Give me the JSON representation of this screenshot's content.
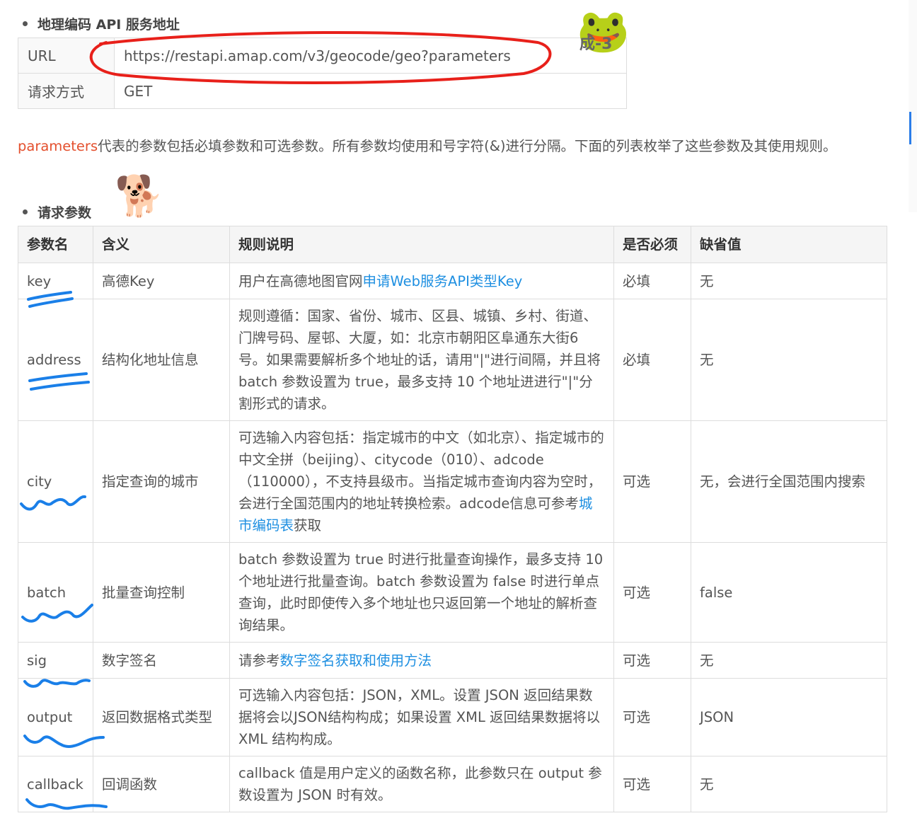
{
  "section1": {
    "title": "地理编码 API 服务地址"
  },
  "url_table": [
    {
      "key": "URL",
      "value": "https://restapi.amap.com/v3/geocode/geo?parameters"
    },
    {
      "key": "请求方式",
      "value": "GET"
    }
  ],
  "description": {
    "highlight": "parameters",
    "text": "代表的参数包括必填参数和可选参数。所有参数均使用和号字符(&)进行分隔。下面的列表枚举了这些参数及其使用规则。"
  },
  "section2": {
    "title": "请求参数"
  },
  "param_table": {
    "headers": [
      "参数名",
      "含义",
      "规则说明",
      "是否必须",
      "缺省值"
    ],
    "rows": [
      {
        "name": "key",
        "meaning": "高德Key",
        "rule_pre": "用户在高德地图官网",
        "rule_link": "申请Web服务API类型Key",
        "rule_post": "",
        "required": "必填",
        "default": "无"
      },
      {
        "name": "address",
        "meaning": "结构化地址信息",
        "rule_pre": "规则遵循：国家、省份、城市、区县、城镇、乡村、街道、门牌号码、屋邨、大厦，如：北京市朝阳区阜通东大街6号。如果需要解析多个地址的话，请用\"|\"进行间隔，并且将 batch 参数设置为 true，最多支持 10 个地址进进行\"|\"分割形式的请求。",
        "rule_link": "",
        "rule_post": "",
        "required": "必填",
        "default": "无"
      },
      {
        "name": "city",
        "meaning": "指定查询的城市",
        "rule_pre": "可选输入内容包括：指定城市的中文（如北京）、指定城市的中文全拼（beijing）、citycode（010）、adcode（110000），不支持县级市。当指定城市查询内容为空时，会进行全国范围内的地址转换检索。adcode信息可参考",
        "rule_link": "城市编码表",
        "rule_post": "获取",
        "required": "可选",
        "default": "无，会进行全国范围内搜索"
      },
      {
        "name": "batch",
        "meaning": "批量查询控制",
        "rule_pre": "batch 参数设置为 true 时进行批量查询操作，最多支持 10 个地址进行批量查询。batch 参数设置为 false 时进行单点查询，此时即使传入多个地址也只返回第一个地址的解析查询结果。",
        "rule_link": "",
        "rule_post": "",
        "required": "可选",
        "default": "false"
      },
      {
        "name": "sig",
        "meaning": "数字签名",
        "rule_pre": "请参考",
        "rule_link": "数字签名获取和使用方法",
        "rule_post": "",
        "required": "可选",
        "default": "无"
      },
      {
        "name": "output",
        "meaning": "返回数据格式类型",
        "rule_pre": "可选输入内容包括：JSON，XML。设置 JSON 返回结果数据将会以JSON结构构成；如果设置 XML 返回结果数据将以 XML 结构构成。",
        "rule_link": "",
        "rule_post": "",
        "required": "可选",
        "default": "JSON"
      },
      {
        "name": "callback",
        "meaning": "回调函数",
        "rule_pre": "callback 值是用户定义的函数名称，此参数只在 output 参数设置为 JSON 时有效。",
        "rule_link": "",
        "rule_post": "",
        "required": "可选",
        "default": "无"
      }
    ]
  },
  "stickers": {
    "frog": {
      "icon": "frog-sticker-icon",
      "glyph": "🐸",
      "text": "成-3"
    },
    "dog": {
      "icon": "dog-sticker-icon",
      "glyph": "🐕"
    }
  },
  "colors": {
    "annotation_red": "#e8201a",
    "annotation_blue": "#1a7fe8",
    "link": "#1e8fe1",
    "highlight": "#e4502e"
  }
}
